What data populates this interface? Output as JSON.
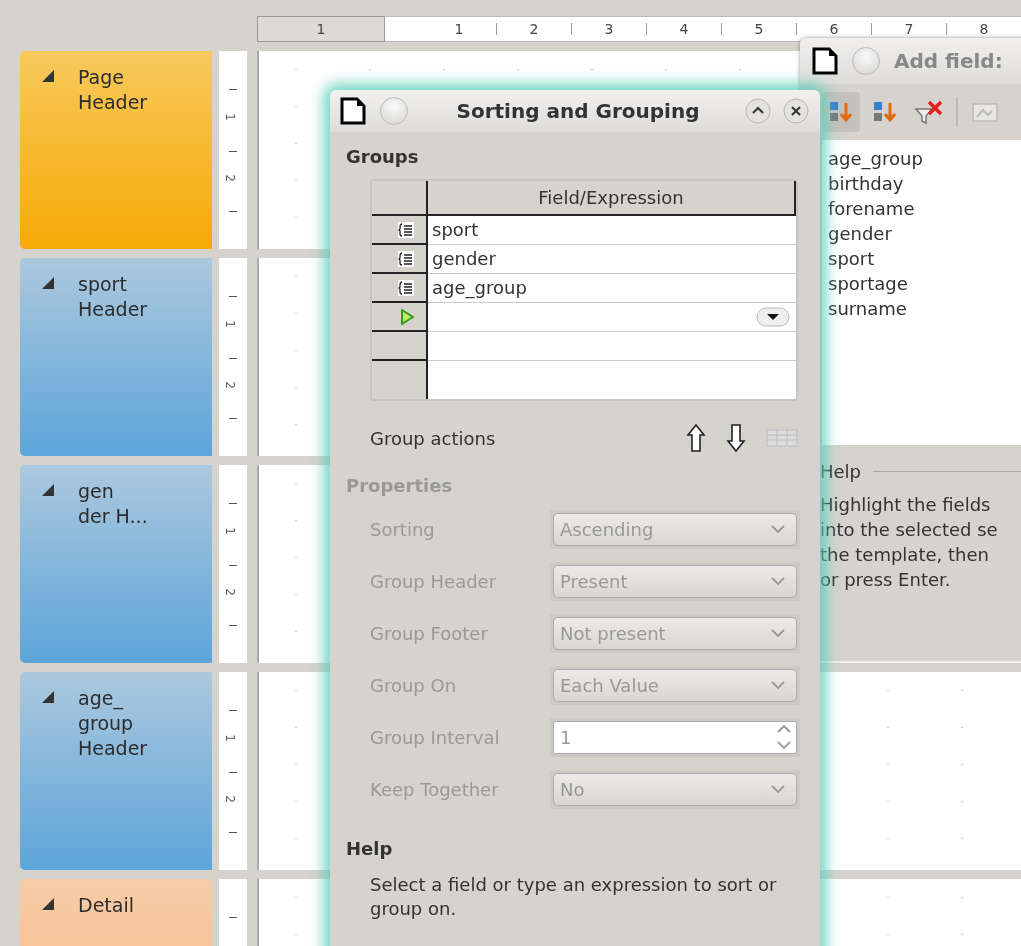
{
  "ruler": {
    "left_numbers": [
      "1"
    ],
    "numbers": [
      "1",
      "2",
      "3",
      "4",
      "5",
      "6",
      "7",
      "8"
    ]
  },
  "sections": [
    {
      "kind": "page",
      "expanded": true,
      "lines": [
        "Page",
        "Header"
      ],
      "ruler_labels": [
        "1",
        "2"
      ]
    },
    {
      "kind": "group",
      "expanded": true,
      "lines": [
        "sport",
        "Header"
      ],
      "ruler_labels": [
        "1",
        "2"
      ]
    },
    {
      "kind": "group",
      "expanded": true,
      "lines": [
        "gen",
        "der H..."
      ],
      "ruler_labels": [
        "1",
        "2"
      ]
    },
    {
      "kind": "group",
      "expanded": true,
      "lines": [
        "age_",
        "group",
        "Header"
      ],
      "ruler_labels": [
        "1",
        "2"
      ]
    },
    {
      "kind": "detail",
      "expanded": true,
      "lines": [
        "Detail"
      ]
    }
  ],
  "sorting_dialog": {
    "title": "Sorting and Grouping",
    "groups_heading": "Groups",
    "table": {
      "columns": [
        "Field/Expression"
      ],
      "rows": [
        {
          "kind": "field",
          "field": "sport"
        },
        {
          "kind": "field",
          "field": "gender"
        },
        {
          "kind": "field",
          "field": "age_group"
        },
        {
          "kind": "insert"
        },
        {
          "kind": "blank"
        }
      ]
    },
    "group_actions": {
      "label": "Group actions"
    },
    "properties_heading": "Properties",
    "properties": [
      {
        "label": "Sorting",
        "kind": "dropdown",
        "value": "Ascending",
        "disabled": true
      },
      {
        "label": "Group Header",
        "kind": "dropdown",
        "value": "Present",
        "disabled": true
      },
      {
        "label": "Group Footer",
        "kind": "dropdown",
        "value": "Not present",
        "disabled": true
      },
      {
        "label": "Group On",
        "kind": "dropdown",
        "value": "Each Value",
        "disabled": true
      },
      {
        "label": "Group Interval",
        "kind": "spin",
        "value": "1",
        "disabled": true
      },
      {
        "label": "Keep Together",
        "kind": "dropdown",
        "value": "No",
        "disabled": true
      }
    ],
    "help_heading": "Help",
    "help_text": "Select a field or type an expression to sort or group on."
  },
  "add_field_dialog": {
    "title": "Add field:",
    "toolbar": [
      {
        "kind": "sort-ascending",
        "selected": true
      },
      {
        "kind": "sort-descending",
        "selected": false
      },
      {
        "kind": "remove-filter",
        "selected": false
      },
      {
        "kind": "insert",
        "selected": false
      }
    ],
    "fields": [
      "age_group",
      "birthday",
      "forename",
      "gender",
      "sport",
      "sportage",
      "surname"
    ],
    "help_heading": "Help",
    "help_lines": [
      "Highlight the fields",
      "into the selected se",
      "the template, then",
      "or press Enter."
    ]
  }
}
